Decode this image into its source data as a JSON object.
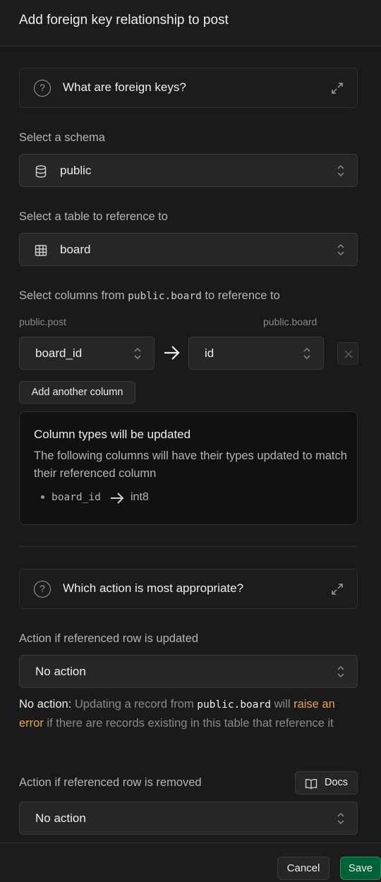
{
  "dialog": {
    "title": "Add foreign key relationship to post"
  },
  "info1": {
    "label": "What are foreign keys?",
    "icon": "question-circle-icon",
    "expand_icon": "expand-icon"
  },
  "schema": {
    "label": "Select a schema",
    "value": "public",
    "icon": "database-icon"
  },
  "table": {
    "label": "Select a table to reference to",
    "value": "board",
    "icon": "table-icon"
  },
  "columns": {
    "label_prefix": "Select columns from ",
    "label_code": "public.board",
    "label_suffix": " to reference to",
    "source_table": "public.post",
    "target_table": "public.board",
    "source_value": "board_id",
    "target_value": "id",
    "add_button": "Add another column"
  },
  "type_notice": {
    "title": "Column types will be updated",
    "description": "The following columns will have their types updated to match their referenced column",
    "items": [
      {
        "column": "board_id",
        "type": "int8"
      }
    ]
  },
  "info2": {
    "label": "Which action is most appropriate?",
    "icon": "question-circle-icon",
    "expand_icon": "expand-icon"
  },
  "on_update": {
    "label": "Action if referenced row is updated",
    "value": "No action",
    "desc_strong": "No action:",
    "desc_1": " Updating a record from ",
    "desc_code": "public.board",
    "desc_2": " will ",
    "desc_warn": "raise an error",
    "desc_3": " if there are records existing in this table that reference it"
  },
  "on_delete": {
    "label": "Action if referenced row is removed",
    "value": "No action",
    "docs_label": "Docs",
    "docs_icon": "book-icon"
  },
  "footer": {
    "cancel_label": "Cancel",
    "save_label": "Save"
  },
  "colors": {
    "accent": "#006239",
    "warning": "#e5a44a",
    "background": "#1c1c1c"
  }
}
